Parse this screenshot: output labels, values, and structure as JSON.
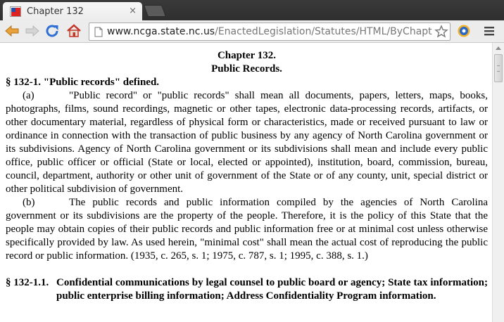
{
  "browser": {
    "tab": {
      "title": "Chapter 132",
      "close_glyph": "×"
    },
    "address_bar": {
      "host": "www.ncga.state.nc.us",
      "path": "/EnactedLegislation/Statutes/HTML/ByChapt"
    },
    "icons": [
      "back-icon",
      "forward-icon",
      "reload-icon",
      "home-icon",
      "page-icon",
      "star-icon",
      "extension-icon",
      "menu-icon"
    ],
    "colors": {
      "toolbar": "#ececec",
      "tabstrip": "#3a3a3a",
      "reload_blue": "#2f6fd6",
      "home_red": "#d23a2c"
    }
  },
  "document": {
    "chapter_line": "Chapter 132.",
    "chapter_name": "Public Records.",
    "section_1": {
      "heading": "§ 132-1.  \"Public records\" defined.",
      "a_label": "(a)",
      "a_text": "\"Public record\" or \"public records\" shall mean all documents, papers, letters, maps, books, photographs, films, sound recordings, magnetic or other tapes, electronic data-processing records, artifacts, or other documentary material, regardless of physical form or characteristics, made or received pursuant to law or ordinance in connection with the transaction of public business by any agency of North Carolina government or its subdivisions. Agency of North Carolina government or its subdivisions shall mean and include every public office, public officer or official (State or local, elected or appointed), institution, board, commission, bureau, council, department, authority or other unit of government of the State or of any county, unit, special district or other political subdivision of government.",
      "b_label": "(b)",
      "b_text": "The public records and public information compiled by the agencies of North Carolina government or its subdivisions are the property of the people. Therefore, it is the policy of this State that the people may obtain copies of their public records and public information free or at minimal cost unless otherwise specifically provided by law. As used herein, \"minimal cost\" shall mean the actual cost of reproducing the public record or public information. (1935, c. 265, s. 1; 1975, c. 787, s. 1; 1995, c. 388, s. 1.)"
    },
    "section_2": {
      "number": "§ 132-1.1.",
      "heading": "Confidential communications by legal counsel to public board or agency; State tax information; public enterprise billing information; Address Confidentiality Program information."
    }
  }
}
